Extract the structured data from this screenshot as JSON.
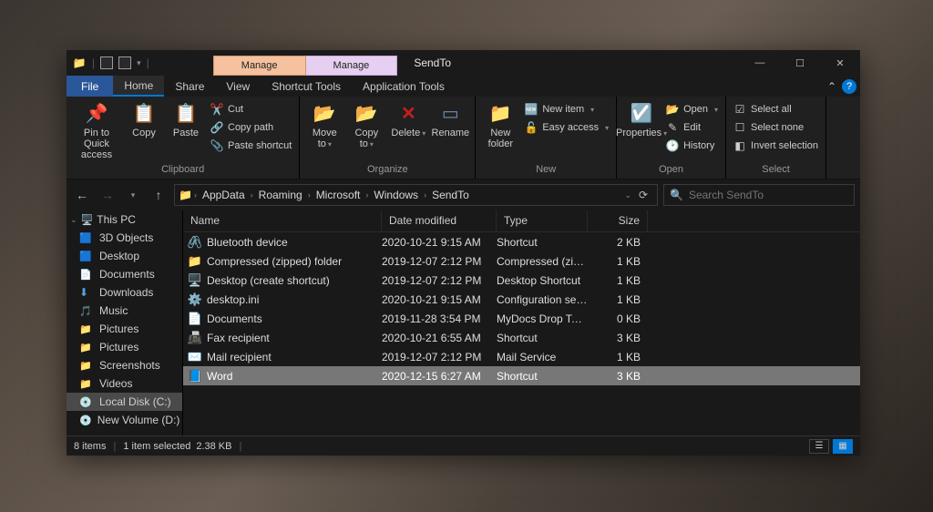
{
  "titlebar": {
    "manage1": "Manage",
    "manage2": "Manage",
    "title": "SendTo",
    "minimize": "—",
    "maximize": "☐",
    "close": "✕"
  },
  "menu": {
    "file": "File",
    "home": "Home",
    "share": "Share",
    "view": "View",
    "shortcut_tools": "Shortcut Tools",
    "application_tools": "Application Tools",
    "collapse": "⌃",
    "help": "?"
  },
  "ribbon": {
    "pin": "Pin to Quick access",
    "copy": "Copy",
    "paste": "Paste",
    "cut": "Cut",
    "copy_path": "Copy path",
    "paste_shortcut": "Paste shortcut",
    "group_clipboard": "Clipboard",
    "move_to": "Move to",
    "copy_to": "Copy to",
    "delete": "Delete",
    "rename": "Rename",
    "group_organize": "Organize",
    "new_folder": "New folder",
    "new_item": "New item",
    "easy_access": "Easy access",
    "group_new": "New",
    "properties": "Properties",
    "open": "Open",
    "edit": "Edit",
    "history": "History",
    "group_open": "Open",
    "select_all": "Select all",
    "select_none": "Select none",
    "invert": "Invert selection",
    "group_select": "Select"
  },
  "nav": {
    "back": "←",
    "forward": "→",
    "up": "↑",
    "crumbs": [
      "AppData",
      "Roaming",
      "Microsoft",
      "Windows",
      "SendTo"
    ],
    "refresh": "⟳",
    "search_placeholder": "Search SendTo",
    "search_icon": "🔍"
  },
  "sidebar": {
    "this_pc": "This PC",
    "items": [
      {
        "icon": "sic-3d",
        "label": "3D Objects"
      },
      {
        "icon": "sic-desktop",
        "label": "Desktop"
      },
      {
        "icon": "sic-docs",
        "label": "Documents"
      },
      {
        "icon": "sic-dl",
        "label": "Downloads"
      },
      {
        "icon": "sic-music",
        "label": "Music"
      },
      {
        "icon": "sic-pics",
        "label": "Pictures"
      },
      {
        "icon": "sic-pics",
        "label": "Pictures"
      },
      {
        "icon": "sic-pics",
        "label": "Screenshots"
      },
      {
        "icon": "sic-vids",
        "label": "Videos"
      },
      {
        "icon": "sic-disk",
        "label": "Local Disk (C:)",
        "sel": true
      },
      {
        "icon": "sic-disk",
        "label": "New Volume (D:)"
      }
    ]
  },
  "columns": {
    "name": "Name",
    "date": "Date modified",
    "type": "Type",
    "size": "Size"
  },
  "files": [
    {
      "icon": "🖇️",
      "name": "Bluetooth device",
      "date": "2020-10-21 9:15 AM",
      "type": "Shortcut",
      "size": "2 KB"
    },
    {
      "icon": "📁",
      "name": "Compressed (zipped) folder",
      "date": "2019-12-07 2:12 PM",
      "type": "Compressed (zipp...",
      "size": "1 KB"
    },
    {
      "icon": "🖥️",
      "name": "Desktop (create shortcut)",
      "date": "2019-12-07 2:12 PM",
      "type": "Desktop Shortcut",
      "size": "1 KB"
    },
    {
      "icon": "⚙️",
      "name": "desktop.ini",
      "date": "2020-10-21 9:15 AM",
      "type": "Configuration setti...",
      "size": "1 KB"
    },
    {
      "icon": "📄",
      "name": "Documents",
      "date": "2019-11-28 3:54 PM",
      "type": "MyDocs Drop Targ...",
      "size": "0 KB"
    },
    {
      "icon": "📠",
      "name": "Fax recipient",
      "date": "2020-10-21 6:55 AM",
      "type": "Shortcut",
      "size": "3 KB"
    },
    {
      "icon": "✉️",
      "name": "Mail recipient",
      "date": "2019-12-07 2:12 PM",
      "type": "Mail Service",
      "size": "1 KB"
    },
    {
      "icon": "📘",
      "name": "Word",
      "date": "2020-12-15 6:27 AM",
      "type": "Shortcut",
      "size": "3 KB",
      "sel": true
    }
  ],
  "status": {
    "items": "8 items",
    "selected": "1 item selected",
    "size": "2.38 KB"
  }
}
